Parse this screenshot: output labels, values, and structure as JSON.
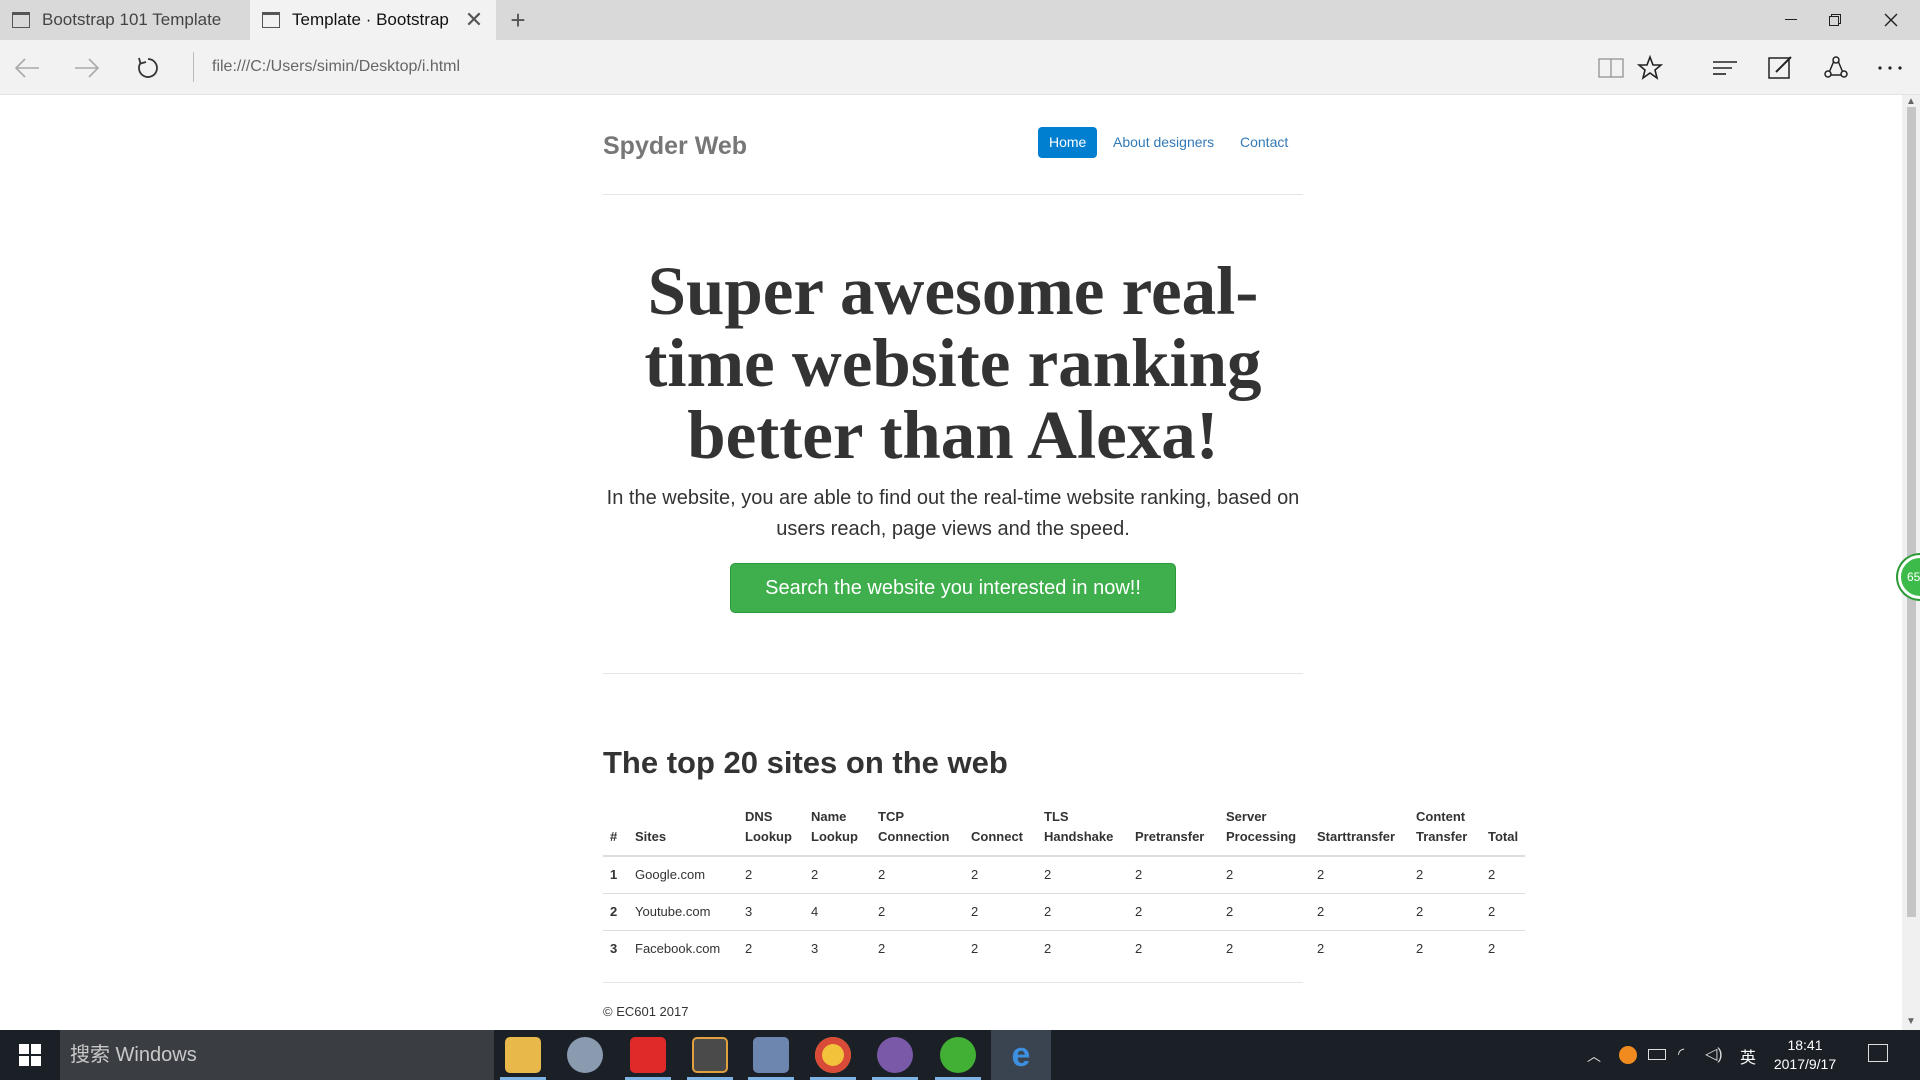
{
  "browser": {
    "tabs": [
      {
        "label": "Bootstrap 101 Template",
        "active": false
      },
      {
        "label": "Template · Bootstrap",
        "active": true
      }
    ],
    "url": "file:///C:/Users/simin/Desktop/i.html"
  },
  "site": {
    "brand": "Spyder Web",
    "nav": [
      {
        "label": "Home",
        "active": true
      },
      {
        "label": "About designers",
        "active": false
      },
      {
        "label": "Contact",
        "active": false
      }
    ],
    "hero": {
      "title": "Super awesome real-time website ranking better than Alexa!",
      "text": "In the website, you are able to find out the real-time website ranking, based on users reach, page views and the speed.",
      "cta": "Search the website you interested in now!!"
    },
    "section_title": "The top 20 sites on the web",
    "table": {
      "headers": [
        "#",
        "Sites",
        "DNS Lookup",
        "Name Lookup",
        "TCP Connection",
        "Connect",
        "TLS Handshake",
        "Pretransfer",
        "Server Processing",
        "Starttransfer",
        "Content Transfer",
        "Total"
      ],
      "rows": [
        [
          "1",
          "Google.com",
          "2",
          "2",
          "2",
          "2",
          "2",
          "2",
          "2",
          "2",
          "2",
          "2"
        ],
        [
          "2",
          "Youtube.com",
          "3",
          "4",
          "2",
          "2",
          "2",
          "2",
          "2",
          "2",
          "2",
          "2"
        ],
        [
          "3",
          "Facebook.com",
          "2",
          "3",
          "2",
          "2",
          "2",
          "2",
          "2",
          "2",
          "2",
          "2"
        ]
      ]
    },
    "footer": "© EC601 2017",
    "badge": "65"
  },
  "taskbar": {
    "search_placeholder": "搜索 Windows",
    "ime": "英",
    "time": "18:41",
    "date": "2017/9/17"
  }
}
